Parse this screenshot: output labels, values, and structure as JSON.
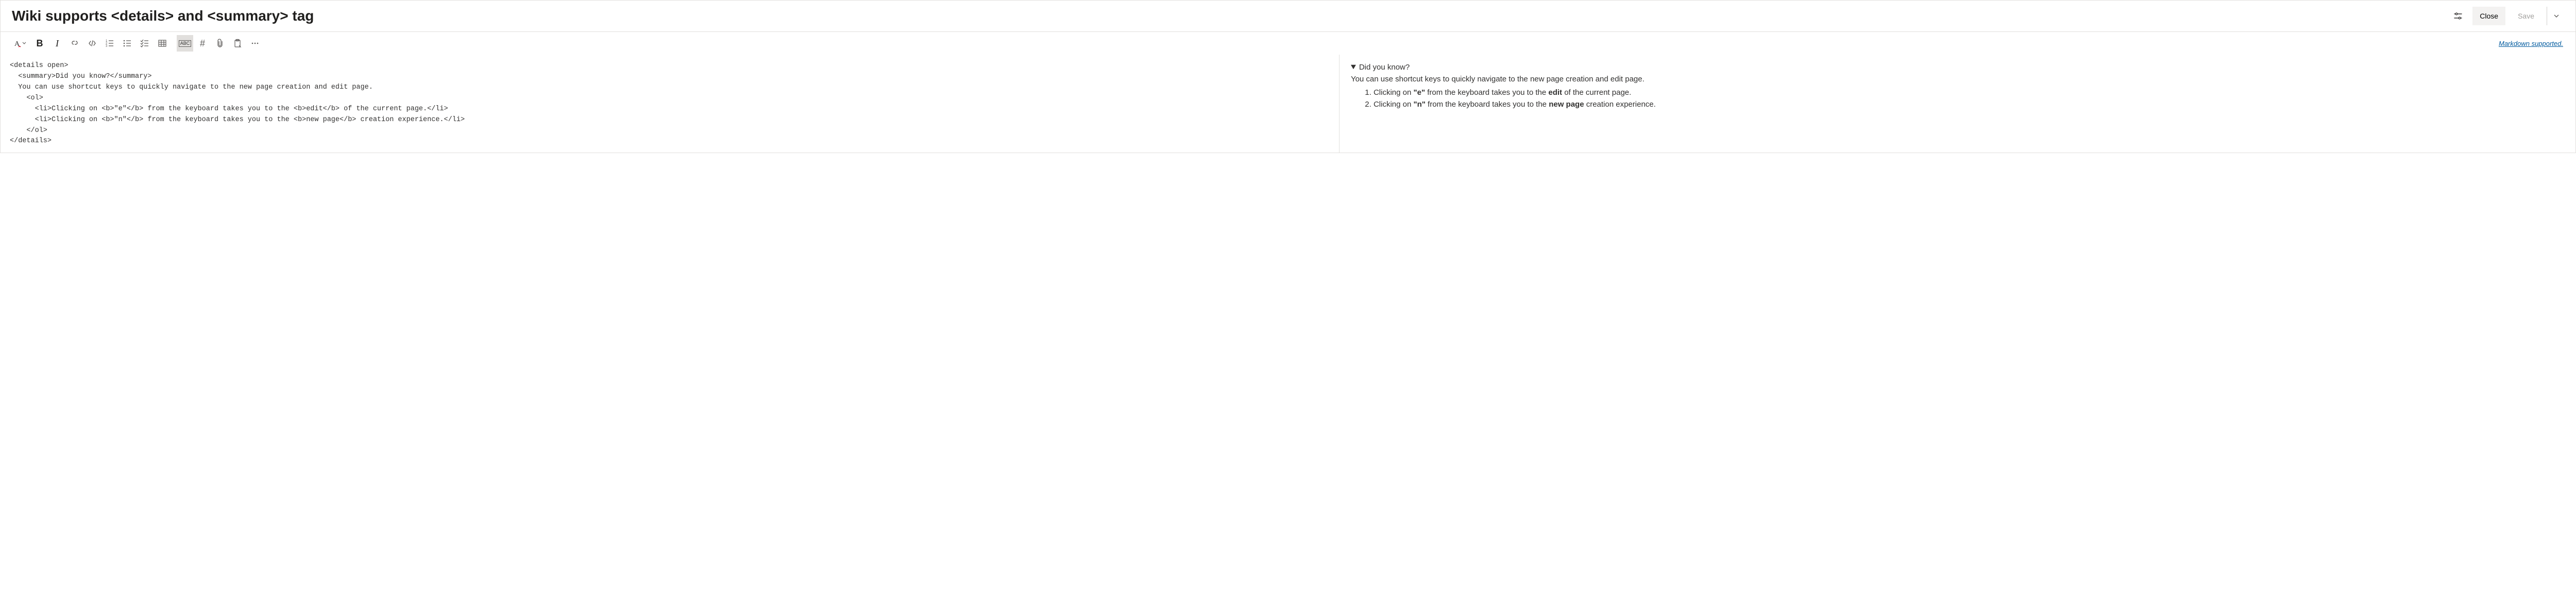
{
  "header": {
    "title_value": "Wiki supports <details> and <summary> tag",
    "close_label": "Close",
    "save_label": "Save"
  },
  "toolbar": {
    "markdown_link": "Markdown supported.",
    "abc_label": "ABC"
  },
  "editor": {
    "source": "<details open>\n  <summary>Did you know?</summary>\n  You can use shortcut keys to quickly navigate to the new page creation and edit page.\n    <ol>\n      <li>Clicking on <b>\"e\"</b> from the keyboard takes you to the <b>edit</b> of the current page.</li>\n      <li>Clicking on <b>\"n\"</b> from the keyboard takes you to the <b>new page</b> creation experience.</li>\n    </ol>\n</details>"
  },
  "preview": {
    "summary": "Did you know?",
    "intro": "You can use shortcut keys to quickly navigate to the new page creation and edit page.",
    "items": [
      {
        "pre": "Clicking on ",
        "b1": "\"e\"",
        "mid": " from the keyboard takes you to the ",
        "b2": "edit",
        "post": " of the current page."
      },
      {
        "pre": "Clicking on ",
        "b1": "\"n\"",
        "mid": " from the keyboard takes you to the ",
        "b2": "new page",
        "post": " creation experience."
      }
    ]
  }
}
